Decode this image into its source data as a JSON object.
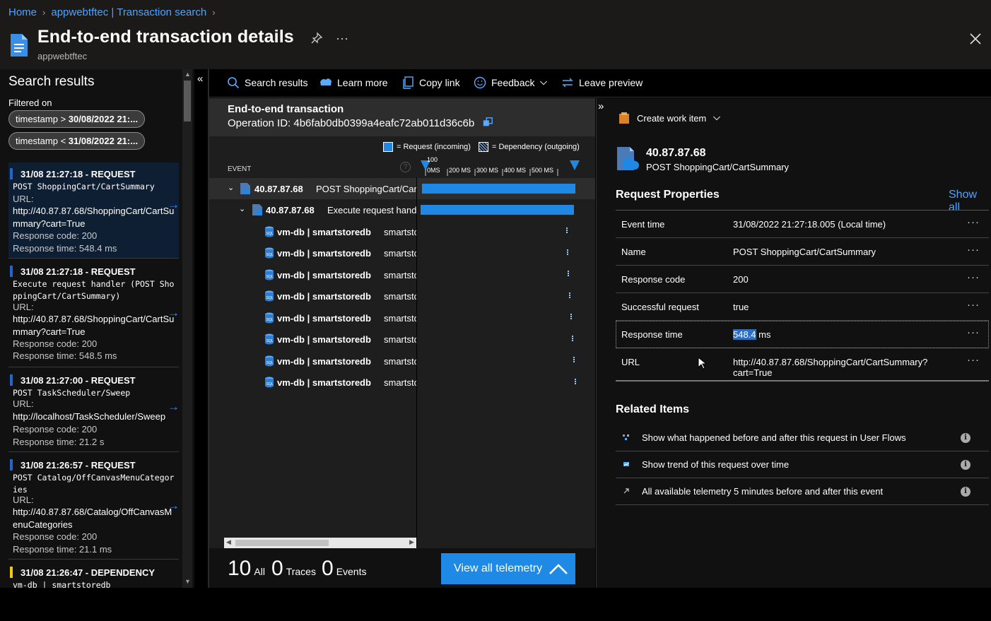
{
  "breadcrumb": {
    "home": "Home",
    "parent": "appwebtftec | Transaction search"
  },
  "header": {
    "title": "End-to-end transaction details",
    "subtitle": "appwebtftec"
  },
  "search_panel": {
    "title": "Search results",
    "filtered_label": "Filtered on",
    "filters": [
      {
        "prefix": "timestamp > ",
        "value": "30/08/2022 21:..."
      },
      {
        "prefix": "timestamp < ",
        "value": "31/08/2022 21:..."
      }
    ],
    "results": [
      {
        "head": "31/08 21:27:18 - REQUEST",
        "op": "POST ShoppingCart/CartSummary",
        "url_label": "URL:",
        "url": "http://40.87.87.68/ShoppingCart/CartSummary?cart=True",
        "code": "Response code: 200",
        "time": "Response time: 548.4 ms",
        "bar": "blue"
      },
      {
        "head": "31/08 21:27:18 - REQUEST",
        "op": "Execute request handler (POST ShoppingCart/CartSummary)",
        "url_label": "URL:",
        "url": "http://40.87.87.68/ShoppingCart/CartSummary?cart=True",
        "code": "Response code: 200",
        "time": "Response time: 548.5 ms",
        "bar": "blue"
      },
      {
        "head": "31/08 21:27:00 - REQUEST",
        "op": "POST TaskScheduler/Sweep",
        "url_label": "URL:",
        "url": "http://localhost/TaskScheduler/Sweep",
        "code": "Response code: 200",
        "time": "Response time: 21.2 s",
        "bar": "blue"
      },
      {
        "head": "31/08 21:26:57 - REQUEST",
        "op": "POST Catalog/OffCanvasMenuCategories",
        "url_label": "URL:",
        "url": "http://40.87.87.68/Catalog/OffCanvasMenuCategories",
        "code": "Response code: 200",
        "time": "Response time: 21.1 ms",
        "bar": "blue"
      },
      {
        "head": "31/08 21:26:47 - DEPENDENCY",
        "op": "vm-db | smartstoredb",
        "bar": "yellow"
      }
    ]
  },
  "toolbar": {
    "search_results": "Search results",
    "learn_more": "Learn more",
    "copy_link": "Copy link",
    "feedback": "Feedback",
    "leave_preview": "Leave preview"
  },
  "transaction": {
    "title": "End-to-end transaction",
    "operation_id": "Operation ID: 4b6fab0db0399a4eafc72ab011d36c6b",
    "legend_request": "= Request (incoming)",
    "legend_dependency": "= Dependency (outgoing)",
    "event_col": "EVENT",
    "scale_ticks": [
      "0MS",
      "100",
      "200 MS",
      "300 MS",
      "400 MS",
      "500 MS"
    ],
    "rows": [
      {
        "name": "40.87.87.68",
        "desc": "POST ShoppingCart/Cart",
        "level": 0
      },
      {
        "name": "40.87.87.68",
        "desc": "Execute request handl",
        "level": 1
      },
      {
        "name": "vm-db | smartstoredb",
        "desc": "smartstc",
        "level": 2
      },
      {
        "name": "vm-db | smartstoredb",
        "desc": "smartstc",
        "level": 2
      },
      {
        "name": "vm-db | smartstoredb",
        "desc": "smartstc",
        "level": 2
      },
      {
        "name": "vm-db | smartstoredb",
        "desc": "smartstc",
        "level": 2
      },
      {
        "name": "vm-db | smartstoredb",
        "desc": "smartstc",
        "level": 2
      },
      {
        "name": "vm-db | smartstoredb",
        "desc": "smartstc",
        "level": 2
      },
      {
        "name": "vm-db | smartstoredb",
        "desc": "smartstc",
        "level": 2
      },
      {
        "name": "vm-db | smartstoredb",
        "desc": "smartstc",
        "level": 2
      }
    ],
    "footer": {
      "all_count": "10",
      "all_label": "All",
      "traces_count": "0",
      "traces_label": "Traces",
      "events_count": "0",
      "events_label": "Events",
      "view_all": "View all telemetry"
    }
  },
  "details": {
    "create_work_item": "Create work item",
    "ip": "40.87.87.68",
    "operation": "POST ShoppingCart/CartSummary",
    "request_properties_title": "Request Properties",
    "show_all": "Show all",
    "properties": [
      {
        "key": "Event time",
        "value": "31/08/2022 21:27:18.005 (Local time)"
      },
      {
        "key": "Name",
        "value": "POST ShoppingCart/CartSummary"
      },
      {
        "key": "Response code",
        "value": "200"
      },
      {
        "key": "Successful request",
        "value": "true"
      },
      {
        "key": "Response time",
        "value_hl": "548.4",
        "value_rest": " ms"
      },
      {
        "key": "URL",
        "value": "http://40.87.87.68/ShoppingCart/CartSummary?cart=True"
      }
    ],
    "related_title": "Related Items",
    "related": [
      "Show what happened before and after this request in User Flows",
      "Show trend of this request over time",
      "All available telemetry 5 minutes before and after this event"
    ]
  },
  "colors": {
    "accent": "#1f88e5",
    "link": "#4ea3ff",
    "dependency_bar": "#f2c811"
  }
}
